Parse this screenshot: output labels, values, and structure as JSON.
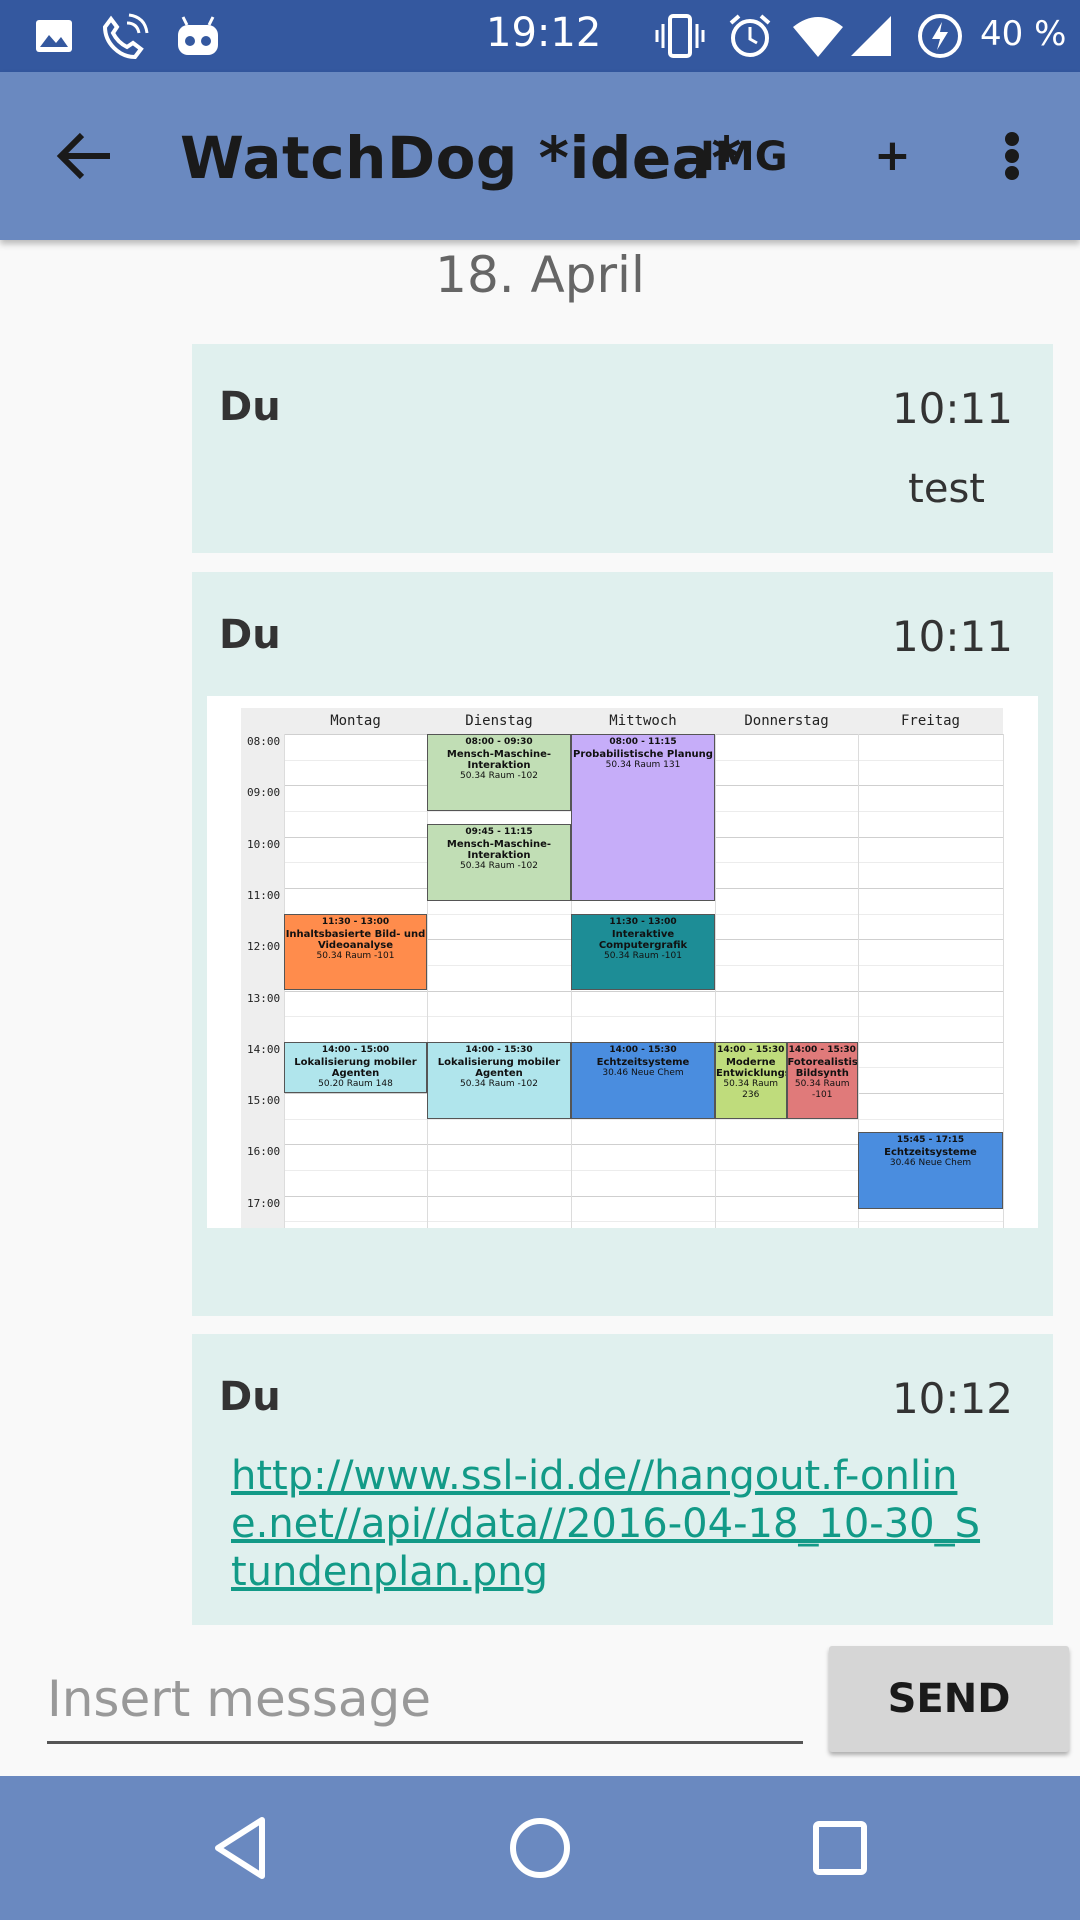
{
  "status_bar": {
    "time": "19:12",
    "battery_percent": "40 %",
    "icons": [
      "image-icon",
      "wifi-calling-icon",
      "android-robot-icon",
      "vibrate-icon",
      "alarm-icon",
      "wifi-icon",
      "cell-signal-icon",
      "battery-charging-icon"
    ]
  },
  "app_bar": {
    "title": "WatchDog *idea*",
    "img_label": "IMG",
    "add_label": "+"
  },
  "date_header": "18. April",
  "messages": [
    {
      "sender": "Du",
      "time": "10:11",
      "text": "test"
    },
    {
      "sender": "Du",
      "time": "10:11",
      "image": "schedule"
    },
    {
      "sender": "Du",
      "time": "10:12",
      "link": "http://www.ssl-id.de//hangout.f-online.net//api//data//2016-04-18_10-30_Stundenplan.png"
    }
  ],
  "schedule": {
    "days": [
      "Montag",
      "Dienstag",
      "Mittwoch",
      "Donnerstag",
      "Freitag"
    ],
    "times": [
      "08:00",
      "09:00",
      "10:00",
      "11:00",
      "12:00",
      "13:00",
      "14:00",
      "15:00",
      "16:00",
      "17:00"
    ],
    "events": [
      {
        "time": "08:00 - 09:30",
        "name": "Mensch-Maschine-Interaktion",
        "room": "50.34 Raum -102",
        "color": "#c1deb5"
      },
      {
        "time": "09:45 - 11:15",
        "name": "Mensch-Maschine-Interaktion",
        "room": "50.34 Raum -102",
        "color": "#c1deb5"
      },
      {
        "time": "08:00 - 11:15",
        "name": "Probabilistische Planung",
        "room": "50.34 Raum 131",
        "color": "#c6adf9"
      },
      {
        "time": "11:30 - 13:00",
        "name": "Inhaltsbasierte Bild- und Videoanalyse",
        "room": "50.34 Raum -101",
        "color": "#ff8c4c"
      },
      {
        "time": "11:30 - 13:00",
        "name": "Interaktive Computergrafik",
        "room": "50.34 Raum -101",
        "color": "#1d8d96"
      },
      {
        "time": "14:00 - 15:00",
        "name": "Lokalisierung mobiler Agenten",
        "room": "50.20 Raum 148",
        "color": "#b0e5ec"
      },
      {
        "time": "14:00 - 15:30",
        "name": "Lokalisierung mobiler Agenten",
        "room": "50.34 Raum -102",
        "color": "#b0e5ec"
      },
      {
        "time": "14:00 - 15:30",
        "name": "Echtzeitsysteme",
        "room": "30.46 Neue Chem",
        "color": "#4a8ddf"
      },
      {
        "time": "14:00 - 15:30",
        "name": "Moderne Entwicklungsumge",
        "room": "50.34 Raum 236",
        "color": "#bfdc7c"
      },
      {
        "time": "14:00 - 15:30",
        "name": "Fotorealistische Bildsynth",
        "room": "50.34 Raum -101",
        "color": "#e07a7a"
      },
      {
        "time": "15:45 - 17:15",
        "name": "Echtzeitsysteme",
        "room": "30.46 Neue Chem",
        "color": "#4a8ddf"
      }
    ]
  },
  "input": {
    "placeholder": "Insert message",
    "send_label": "SEND"
  },
  "colors": {
    "status_bar": "#34589f",
    "app_bar": "#6a89c0",
    "card": "#e0f0ee",
    "link": "#129a87"
  }
}
